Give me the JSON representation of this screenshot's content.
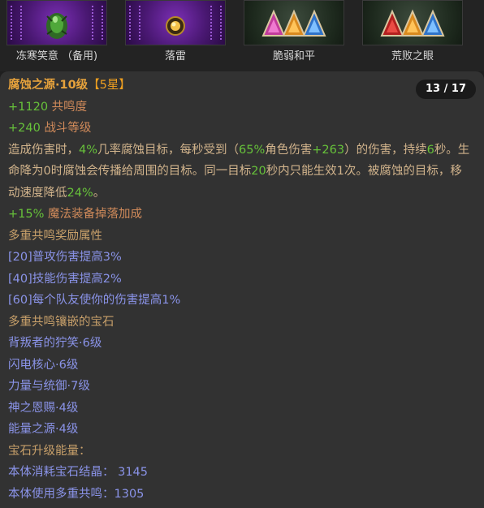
{
  "slots": [
    {
      "caption": "冻寒笑意 （备用)"
    },
    {
      "caption": "落雷"
    },
    {
      "caption": "脆弱和平"
    },
    {
      "caption": "荒败之眼"
    }
  ],
  "tooltip": {
    "counter": "13 / 17",
    "title_name": "腐蚀之源·10级",
    "title_stars": "【5星】",
    "stat1_value": "+1120",
    "stat1_label": "共鸣度",
    "stat2_value": "+240",
    "stat2_label": "战斗等级",
    "desc": {
      "p1": "造成伤害时，",
      "v1": "4%",
      "p2": "几率腐蚀目标，每秒受到（",
      "v2": "65%",
      "p3": "角色伤害",
      "v3": "+263",
      "p4": "）的伤害，持续",
      "v4": "6",
      "p5": "秒。生命降为0时腐蚀会传播给周围的目标。同一目标",
      "v5": "20",
      "p6": "秒内只能生效1次。被腐蚀的目标，移动速度降低",
      "v6": "24%",
      "p7": "。"
    },
    "magic_value": "+15%",
    "magic_label": "魔法装备掉落加成",
    "reward_heading": "多重共鸣奖励属性",
    "rewards": [
      "[20]普攻伤害提高3%",
      "[40]技能伤害提高2%",
      "[60]每个队友使你的伤害提高1%"
    ],
    "gems_heading": "多重共鸣镶嵌的宝石",
    "gems": [
      "背叛者的狞笑·6级",
      "闪电核心·6级",
      "力量与统御·7级",
      "神之恩赐·4级",
      "能量之源·4级"
    ],
    "upgrade_heading": "宝石升级能量：",
    "upgrade_lines": [
      "本体消耗宝石结晶： 3145",
      "本体使用多重共鸣：1305"
    ]
  }
}
